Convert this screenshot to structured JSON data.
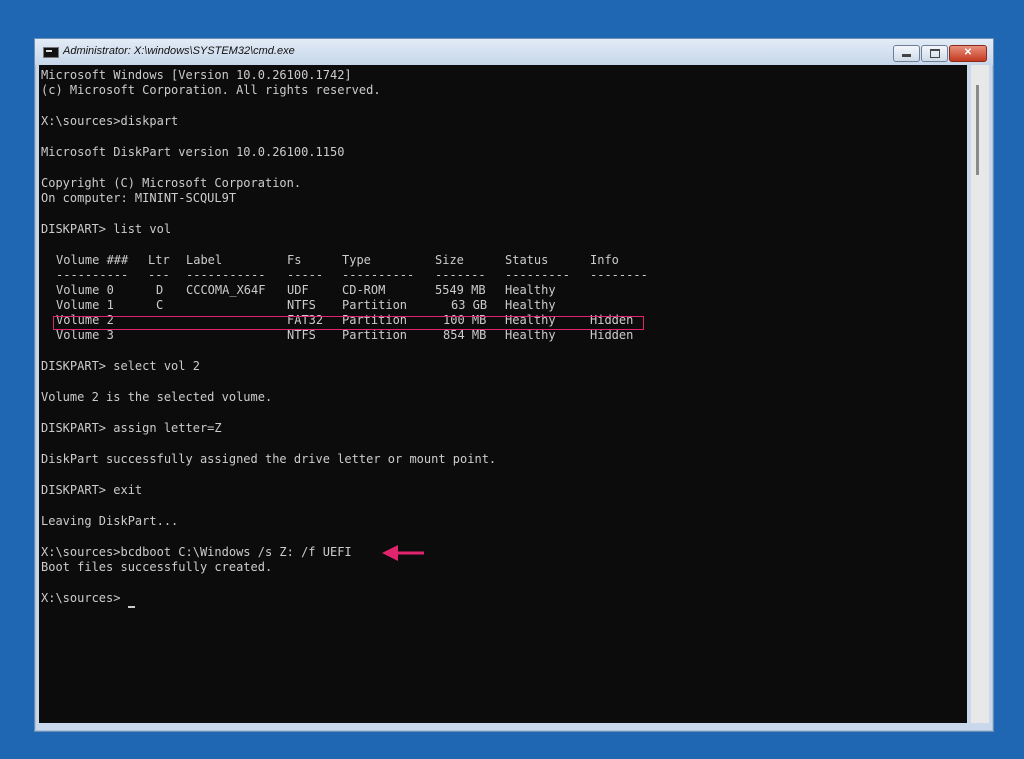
{
  "window": {
    "title": "Administrator: X:\\windows\\SYSTEM32\\cmd.exe",
    "controls": {
      "minimize_icon": "minimize-icon",
      "maximize_icon": "maximize-icon",
      "close_label": "✕"
    }
  },
  "console": {
    "lines": {
      "l1": "Microsoft Windows [Version 10.0.26100.1742]",
      "l2": "(c) Microsoft Corporation. All rights reserved.",
      "l3": "X:\\sources>diskpart",
      "l4": "Microsoft DiskPart version 10.0.26100.1150",
      "l5": "Copyright (C) Microsoft Corporation.",
      "l6": "On computer: MININT-SCQUL9T",
      "l7": "DISKPART> list vol",
      "l8": "DISKPART> select vol 2",
      "l9": "Volume 2 is the selected volume.",
      "l10": "DISKPART> assign letter=Z",
      "l11": "DiskPart successfully assigned the drive letter or mount point.",
      "l12": "DISKPART> exit",
      "l13": "Leaving DiskPart...",
      "l14": "X:\\sources>bcdboot C:\\Windows /s Z: /f UEFI",
      "l15": "Boot files successfully created.",
      "l16": "X:\\sources>"
    },
    "volume_table": {
      "headers": [
        "Volume ###",
        "Ltr",
        "Label",
        "Fs",
        "Type",
        "Size",
        "Status",
        "Info"
      ],
      "separators": [
        "----------",
        "---",
        "-----------",
        "-----",
        "----------",
        "-------",
        "---------",
        "--------"
      ],
      "rows": [
        [
          "Volume 0",
          "D",
          "CCCOMA_X64F",
          "UDF",
          "CD-ROM",
          "5549 MB",
          "Healthy",
          ""
        ],
        [
          "Volume 1",
          "C",
          "",
          "NTFS",
          "Partition",
          "63 GB",
          "Healthy",
          ""
        ],
        [
          "Volume 2",
          "",
          "",
          "FAT32",
          "Partition",
          "100 MB",
          "Healthy",
          "Hidden"
        ],
        [
          "Volume 3",
          "",
          "",
          "NTFS",
          "Partition",
          "854 MB",
          "Healthy",
          "Hidden"
        ]
      ],
      "highlighted_row": 2
    }
  },
  "colors": {
    "console_bg": "#0c0c0c",
    "console_text": "#cccccc",
    "annotation": "#e0246e",
    "desktop": "#2067b3"
  }
}
